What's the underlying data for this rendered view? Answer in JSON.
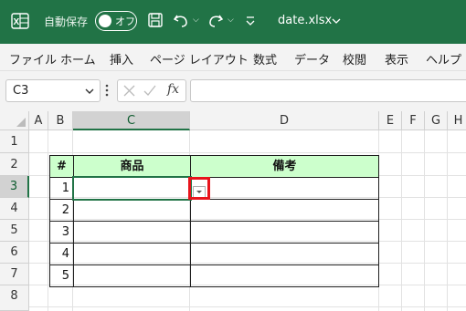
{
  "titlebar": {
    "autosave_label": "自動保存",
    "autosave_toggle": "オフ",
    "filename": "date.xlsx"
  },
  "ribbon": {
    "tabs": [
      "ファイル",
      "ホーム",
      "挿入",
      "ページ レイアウト",
      "数式",
      "データ",
      "校閲",
      "表示",
      "ヘルプ"
    ]
  },
  "formula_bar": {
    "name_box": "C3",
    "fx_label": "fx",
    "formula_value": ""
  },
  "columns": [
    "A",
    "B",
    "C",
    "D",
    "E",
    "F",
    "G",
    "H"
  ],
  "rows": [
    "1",
    "2",
    "3",
    "4",
    "5",
    "6",
    "7",
    "8"
  ],
  "table": {
    "headers": [
      "#",
      "商品",
      "備考"
    ],
    "row_numbers": [
      "1",
      "2",
      "3",
      "4",
      "5"
    ]
  },
  "colors": {
    "title_bar": "#217346",
    "table_header": "#ccffcc",
    "highlight": "#e8141c"
  },
  "selected_cell": "C3"
}
